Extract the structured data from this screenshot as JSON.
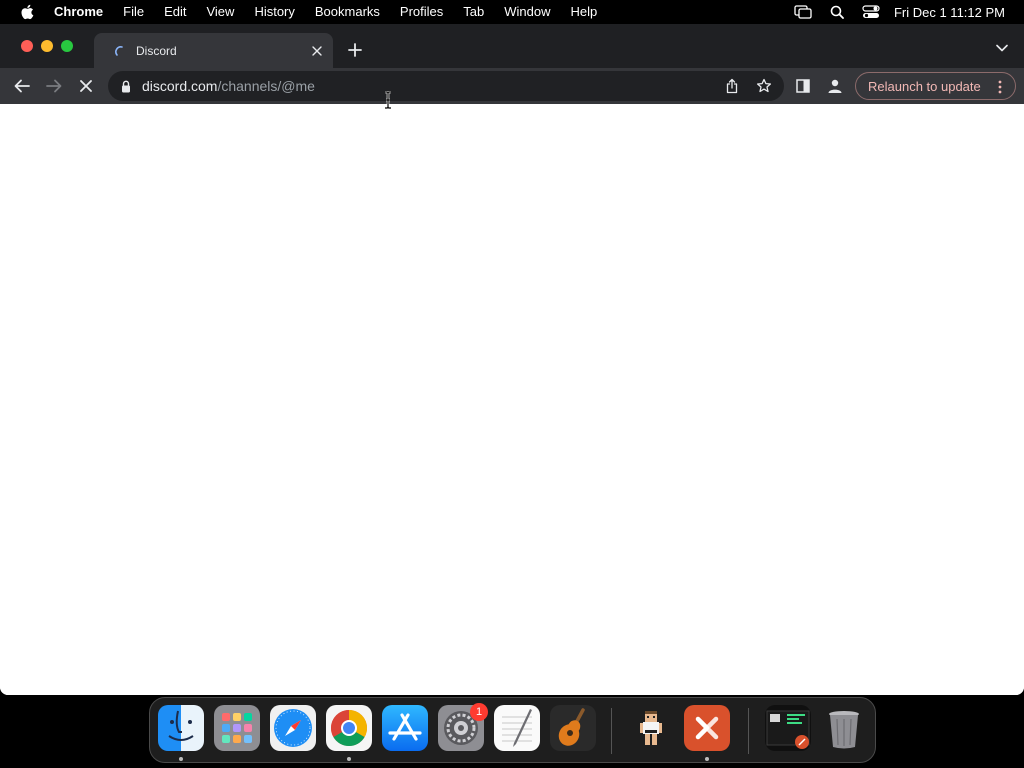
{
  "menubar": {
    "app_name": "Chrome",
    "menus": [
      "File",
      "Edit",
      "View",
      "History",
      "Bookmarks",
      "Profiles",
      "Tab",
      "Window",
      "Help"
    ],
    "clock": "Fri Dec 1  11:12 PM",
    "status_icons": [
      "screen-mirroring-icon",
      "spotlight-search-icon",
      "control-center-icon"
    ]
  },
  "browser": {
    "tab": {
      "title": "Discord",
      "favicon": "loading-spinner-icon"
    },
    "address": {
      "host": "discord.com",
      "path": "/channels/@me"
    },
    "relaunch_label": "Relaunch to update",
    "page_state": "loading"
  },
  "dock": {
    "apps": [
      {
        "name": "Finder",
        "icon": "finder-icon",
        "running": true
      },
      {
        "name": "Launchpad",
        "icon": "launchpad-icon",
        "running": false
      },
      {
        "name": "Safari",
        "icon": "safari-icon",
        "running": false
      },
      {
        "name": "Google Chrome",
        "icon": "chrome-icon",
        "running": true
      },
      {
        "name": "App Store",
        "icon": "app-store-icon",
        "running": false
      },
      {
        "name": "System Preferences",
        "icon": "system-preferences-icon",
        "running": false,
        "badge": "1"
      },
      {
        "name": "TextEdit",
        "icon": "textedit-icon",
        "running": false
      },
      {
        "name": "GarageBand",
        "icon": "garageband-icon",
        "running": false
      },
      {
        "name": "Game character",
        "icon": "pixel-character-icon",
        "running": false
      },
      {
        "name": "Remote Desktop",
        "icon": "remote-desktop-icon",
        "running": true
      },
      {
        "name": "Screenshot window",
        "icon": "window-thumbnail-icon",
        "running": false
      },
      {
        "name": "Trash",
        "icon": "trash-icon",
        "running": false
      }
    ]
  },
  "colors": {
    "tabstrip": "#1f2023",
    "toolbar": "#35363a",
    "omnibox": "#202124",
    "relaunch_text": "#f2b8b5",
    "badge": "#ff3b30"
  }
}
